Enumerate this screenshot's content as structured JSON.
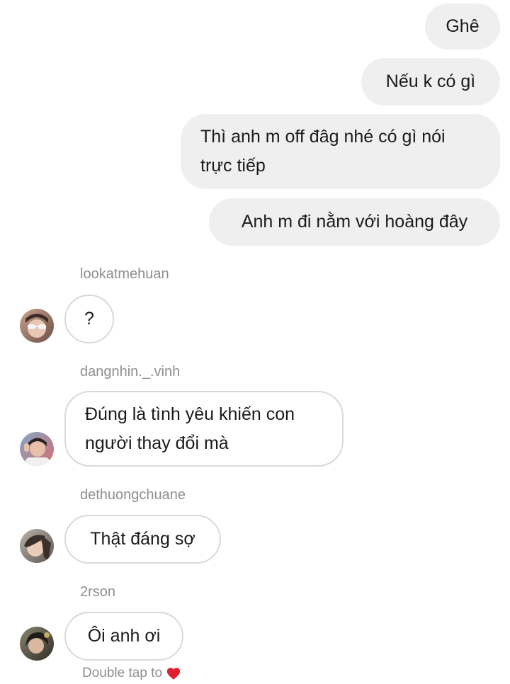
{
  "outgoing": [
    {
      "text": "Ghê"
    },
    {
      "text": "Nếu k có gì"
    },
    {
      "text": "Thì anh m off đâg nhé có gì nói trực tiếp"
    },
    {
      "text": "Anh m đi nằm với hoàng đây"
    }
  ],
  "incoming": [
    {
      "sender": "lookatmehuan",
      "text": "?"
    },
    {
      "sender": "dangnhin._.vinh",
      "text": "Đúng là tình yêu khiến con người thay đổi mà"
    },
    {
      "sender": "dethuongchuane",
      "text": "Thật đáng sợ"
    },
    {
      "sender": "2rson",
      "text": "Ôi anh ơi"
    }
  ],
  "footer": {
    "hint": "Double tap to",
    "heart_icon": "heart-icon",
    "heart_color": "#e0202e"
  },
  "colors": {
    "outgoing_bubble": "#efefef",
    "incoming_border": "#d9d9d9",
    "meta_text": "#8e8e8e"
  }
}
